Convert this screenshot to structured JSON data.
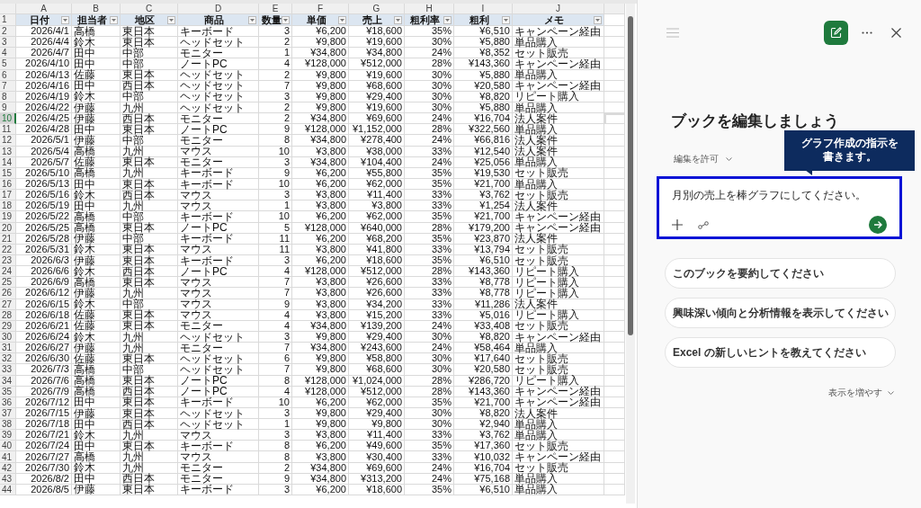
{
  "sheet": {
    "column_letters": [
      "A",
      "B",
      "C",
      "D",
      "E",
      "F",
      "G",
      "H",
      "I",
      "J"
    ],
    "header_row": "1",
    "headers": [
      "日付",
      "担当者",
      "地区",
      "商品",
      "数量",
      "単価",
      "売上",
      "粗利率",
      "粗利",
      "メモ"
    ],
    "rows": [
      {
        "n": "2",
        "selected": false,
        "cells": [
          "2026/4/1",
          "高橋",
          "東日本",
          "キーボード",
          "3",
          "¥6,200",
          "¥18,600",
          "35%",
          "¥6,510",
          "キャンペーン経由"
        ]
      },
      {
        "n": "3",
        "selected": false,
        "cells": [
          "2026/4/4",
          "鈴木",
          "東日本",
          "ヘッドセット",
          "2",
          "¥9,800",
          "¥19,600",
          "30%",
          "¥5,880",
          "単品購入"
        ]
      },
      {
        "n": "4",
        "selected": false,
        "cells": [
          "2026/4/7",
          "田中",
          "中部",
          "モニター",
          "1",
          "¥34,800",
          "¥34,800",
          "24%",
          "¥8,352",
          "セット販売"
        ]
      },
      {
        "n": "5",
        "selected": false,
        "cells": [
          "2026/4/10",
          "田中",
          "中部",
          "ノートPC",
          "4",
          "¥128,000",
          "¥512,000",
          "28%",
          "¥143,360",
          "キャンペーン経由"
        ]
      },
      {
        "n": "6",
        "selected": false,
        "cells": [
          "2026/4/13",
          "佐藤",
          "東日本",
          "ヘッドセット",
          "2",
          "¥9,800",
          "¥19,600",
          "30%",
          "¥5,880",
          "単品購入"
        ]
      },
      {
        "n": "7",
        "selected": false,
        "cells": [
          "2026/4/16",
          "田中",
          "西日本",
          "ヘッドセット",
          "7",
          "¥9,800",
          "¥68,600",
          "30%",
          "¥20,580",
          "キャンペーン経由"
        ]
      },
      {
        "n": "8",
        "selected": false,
        "cells": [
          "2026/4/19",
          "鈴木",
          "中部",
          "ヘッドセット",
          "3",
          "¥9,800",
          "¥29,400",
          "30%",
          "¥8,820",
          "リピート購入"
        ]
      },
      {
        "n": "9",
        "selected": false,
        "cells": [
          "2026/4/22",
          "伊藤",
          "九州",
          "ヘッドセット",
          "2",
          "¥9,800",
          "¥19,600",
          "30%",
          "¥5,880",
          "単品購入"
        ]
      },
      {
        "n": "10",
        "selected": true,
        "cells": [
          "2026/4/25",
          "伊藤",
          "西日本",
          "モニター",
          "2",
          "¥34,800",
          "¥69,600",
          "24%",
          "¥16,704",
          "法人案件"
        ]
      },
      {
        "n": "11",
        "selected": false,
        "cells": [
          "2026/4/28",
          "田中",
          "東日本",
          "ノートPC",
          "9",
          "¥128,000",
          "¥1,152,000",
          "28%",
          "¥322,560",
          "単品購入"
        ]
      },
      {
        "n": "12",
        "selected": false,
        "cells": [
          "2026/5/1",
          "伊藤",
          "中部",
          "モニター",
          "8",
          "¥34,800",
          "¥278,400",
          "24%",
          "¥66,816",
          "法人案件"
        ]
      },
      {
        "n": "13",
        "selected": false,
        "cells": [
          "2026/5/4",
          "高橋",
          "九州",
          "マウス",
          "10",
          "¥3,800",
          "¥38,000",
          "33%",
          "¥12,540",
          "法人案件"
        ]
      },
      {
        "n": "14",
        "selected": false,
        "cells": [
          "2026/5/7",
          "佐藤",
          "東日本",
          "モニター",
          "3",
          "¥34,800",
          "¥104,400",
          "24%",
          "¥25,056",
          "単品購入"
        ]
      },
      {
        "n": "15",
        "selected": false,
        "cells": [
          "2026/5/10",
          "高橋",
          "九州",
          "キーボード",
          "9",
          "¥6,200",
          "¥55,800",
          "35%",
          "¥19,530",
          "セット販売"
        ]
      },
      {
        "n": "16",
        "selected": false,
        "cells": [
          "2026/5/13",
          "田中",
          "東日本",
          "キーボード",
          "10",
          "¥6,200",
          "¥62,000",
          "35%",
          "¥21,700",
          "単品購入"
        ]
      },
      {
        "n": "17",
        "selected": false,
        "cells": [
          "2026/5/16",
          "鈴木",
          "西日本",
          "マウス",
          "3",
          "¥3,800",
          "¥11,400",
          "33%",
          "¥3,762",
          "セット販売"
        ]
      },
      {
        "n": "18",
        "selected": false,
        "cells": [
          "2026/5/19",
          "田中",
          "九州",
          "マウス",
          "1",
          "¥3,800",
          "¥3,800",
          "33%",
          "¥1,254",
          "法人案件"
        ]
      },
      {
        "n": "19",
        "selected": false,
        "cells": [
          "2026/5/22",
          "高橋",
          "中部",
          "キーボード",
          "10",
          "¥6,200",
          "¥62,000",
          "35%",
          "¥21,700",
          "キャンペーン経由"
        ]
      },
      {
        "n": "20",
        "selected": false,
        "cells": [
          "2026/5/25",
          "高橋",
          "東日本",
          "ノートPC",
          "5",
          "¥128,000",
          "¥640,000",
          "28%",
          "¥179,200",
          "キャンペーン経由"
        ]
      },
      {
        "n": "21",
        "selected": false,
        "cells": [
          "2026/5/28",
          "伊藤",
          "中部",
          "キーボード",
          "11",
          "¥6,200",
          "¥68,200",
          "35%",
          "¥23,870",
          "法人案件"
        ]
      },
      {
        "n": "22",
        "selected": false,
        "cells": [
          "2026/5/31",
          "鈴木",
          "東日本",
          "マウス",
          "11",
          "¥3,800",
          "¥41,800",
          "33%",
          "¥13,794",
          "セット販売"
        ]
      },
      {
        "n": "23",
        "selected": false,
        "cells": [
          "2026/6/3",
          "伊藤",
          "東日本",
          "キーボード",
          "3",
          "¥6,200",
          "¥18,600",
          "35%",
          "¥6,510",
          "セット販売"
        ]
      },
      {
        "n": "24",
        "selected": false,
        "cells": [
          "2026/6/6",
          "鈴木",
          "西日本",
          "ノートPC",
          "4",
          "¥128,000",
          "¥512,000",
          "28%",
          "¥143,360",
          "リピート購入"
        ]
      },
      {
        "n": "25",
        "selected": false,
        "cells": [
          "2026/6/9",
          "高橋",
          "東日本",
          "マウス",
          "7",
          "¥3,800",
          "¥26,600",
          "33%",
          "¥8,778",
          "リピート購入"
        ]
      },
      {
        "n": "26",
        "selected": false,
        "cells": [
          "2026/6/12",
          "伊藤",
          "九州",
          "マウス",
          "7",
          "¥3,800",
          "¥26,600",
          "33%",
          "¥8,778",
          "リピート購入"
        ]
      },
      {
        "n": "27",
        "selected": false,
        "cells": [
          "2026/6/15",
          "鈴木",
          "中部",
          "マウス",
          "9",
          "¥3,800",
          "¥34,200",
          "33%",
          "¥11,286",
          "法人案件"
        ]
      },
      {
        "n": "28",
        "selected": false,
        "cells": [
          "2026/6/18",
          "佐藤",
          "東日本",
          "マウス",
          "4",
          "¥3,800",
          "¥15,200",
          "33%",
          "¥5,016",
          "リピート購入"
        ]
      },
      {
        "n": "29",
        "selected": false,
        "cells": [
          "2026/6/21",
          "佐藤",
          "東日本",
          "モニター",
          "4",
          "¥34,800",
          "¥139,200",
          "24%",
          "¥33,408",
          "セット販売"
        ]
      },
      {
        "n": "30",
        "selected": false,
        "cells": [
          "2026/6/24",
          "鈴木",
          "九州",
          "ヘッドセット",
          "3",
          "¥9,800",
          "¥29,400",
          "30%",
          "¥8,820",
          "キャンペーン経由"
        ]
      },
      {
        "n": "31",
        "selected": false,
        "cells": [
          "2026/6/27",
          "伊藤",
          "九州",
          "モニター",
          "7",
          "¥34,800",
          "¥243,600",
          "24%",
          "¥58,464",
          "単品購入"
        ]
      },
      {
        "n": "32",
        "selected": false,
        "cells": [
          "2026/6/30",
          "佐藤",
          "東日本",
          "ヘッドセット",
          "6",
          "¥9,800",
          "¥58,800",
          "30%",
          "¥17,640",
          "セット販売"
        ]
      },
      {
        "n": "33",
        "selected": false,
        "cells": [
          "2026/7/3",
          "高橋",
          "中部",
          "ヘッドセット",
          "7",
          "¥9,800",
          "¥68,600",
          "30%",
          "¥20,580",
          "セット販売"
        ]
      },
      {
        "n": "34",
        "selected": false,
        "cells": [
          "2026/7/6",
          "高橋",
          "東日本",
          "ノートPC",
          "8",
          "¥128,000",
          "¥1,024,000",
          "28%",
          "¥286,720",
          "リピート購入"
        ]
      },
      {
        "n": "35",
        "selected": false,
        "cells": [
          "2026/7/9",
          "高橋",
          "西日本",
          "ノートPC",
          "4",
          "¥128,000",
          "¥512,000",
          "28%",
          "¥143,360",
          "キャンペーン経由"
        ]
      },
      {
        "n": "36",
        "selected": false,
        "cells": [
          "2026/7/12",
          "田中",
          "東日本",
          "キーボード",
          "10",
          "¥6,200",
          "¥62,000",
          "35%",
          "¥21,700",
          "キャンペーン経由"
        ]
      },
      {
        "n": "37",
        "selected": false,
        "cells": [
          "2026/7/15",
          "伊藤",
          "東日本",
          "ヘッドセット",
          "3",
          "¥9,800",
          "¥29,400",
          "30%",
          "¥8,820",
          "法人案件"
        ]
      },
      {
        "n": "38",
        "selected": false,
        "cells": [
          "2026/7/18",
          "田中",
          "西日本",
          "ヘッドセット",
          "1",
          "¥9,800",
          "¥9,800",
          "30%",
          "¥2,940",
          "単品購入"
        ]
      },
      {
        "n": "39",
        "selected": false,
        "cells": [
          "2026/7/21",
          "鈴木",
          "九州",
          "マウス",
          "3",
          "¥3,800",
          "¥11,400",
          "33%",
          "¥3,762",
          "単品購入"
        ]
      },
      {
        "n": "40",
        "selected": false,
        "cells": [
          "2026/7/24",
          "田中",
          "東日本",
          "キーボード",
          "8",
          "¥6,200",
          "¥49,600",
          "35%",
          "¥17,360",
          "セット販売"
        ]
      },
      {
        "n": "41",
        "selected": false,
        "cells": [
          "2026/7/27",
          "高橋",
          "九州",
          "マウス",
          "8",
          "¥3,800",
          "¥30,400",
          "33%",
          "¥10,032",
          "キャンペーン経由"
        ]
      },
      {
        "n": "42",
        "selected": false,
        "cells": [
          "2026/7/30",
          "鈴木",
          "九州",
          "モニター",
          "2",
          "¥34,800",
          "¥69,600",
          "24%",
          "¥16,704",
          "セット販売"
        ]
      },
      {
        "n": "43",
        "selected": false,
        "cells": [
          "2026/8/2",
          "田中",
          "西日本",
          "モニター",
          "9",
          "¥34,800",
          "¥313,200",
          "24%",
          "¥75,168",
          "単品購入"
        ]
      },
      {
        "n": "44",
        "selected": false,
        "cells": [
          "2026/8/5",
          "伊藤",
          "東日本",
          "キーボード",
          "3",
          "¥6,200",
          "¥18,600",
          "35%",
          "¥6,510",
          "単品購入"
        ]
      }
    ]
  },
  "copilot": {
    "title": "ブックを編集しましょう",
    "permission": "編集を許可",
    "callout": "グラフ作成の指示を書きます。",
    "prompt": {
      "value": "月別の売上を棒グラフにしてください。"
    },
    "suggestions": [
      "このブックを要約してください",
      "興味深い傾向と分析情報を表示してください",
      "Excel の新しいヒントを教えてください"
    ],
    "more": "表示を増やす"
  }
}
